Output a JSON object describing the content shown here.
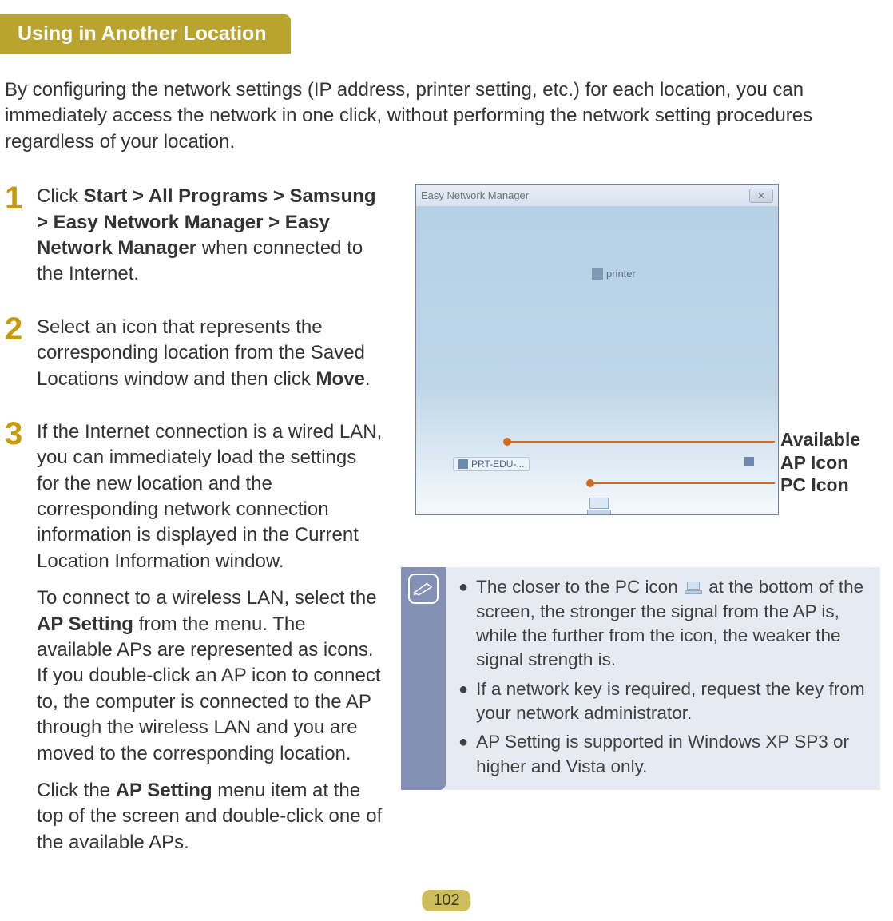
{
  "header": {
    "title": "Using in Another Location"
  },
  "intro": "By configuring the network settings (IP address, printer setting, etc.) for each location, you can immediately access the network in one click, without performing the network setting procedures regardless of your location.",
  "steps": [
    {
      "num": "1",
      "runs": [
        {
          "t": "Click ",
          "b": false
        },
        {
          "t": "Start > All Programs > Samsung > Easy Network Manager > Easy Network Manager",
          "b": true
        },
        {
          "t": " when connected to the Internet.",
          "b": false
        }
      ]
    },
    {
      "num": "2",
      "runs": [
        {
          "t": "Select an icon that represents the corresponding location from the Saved Locations window and then click ",
          "b": false
        },
        {
          "t": "Move",
          "b": true
        },
        {
          "t": ".",
          "b": false
        }
      ]
    },
    {
      "num": "3",
      "paras": [
        [
          {
            "t": "If the Internet connection is a wired LAN, you can immediately load the settings for the new location and the corresponding network connection information is displayed in the Current Location Information window.",
            "b": false
          }
        ],
        [
          {
            "t": "To connect to a wireless LAN, select the ",
            "b": false
          },
          {
            "t": "AP Setting",
            "b": true
          },
          {
            "t": " from the menu. The available APs are represented as icons. If you double-click an AP icon to connect to, the computer is connected to the AP through the wireless LAN and you are moved to the corresponding location.",
            "b": false
          }
        ],
        [
          {
            "t": "Click the ",
            "b": false
          },
          {
            "t": "AP Setting",
            "b": true
          },
          {
            "t": " menu item at the top of the screen and double-click one of the available APs.",
            "b": false
          }
        ]
      ]
    }
  ],
  "app_window": {
    "title": "Easy Network Manager",
    "close_glyph": "✕",
    "printer_label": "printer",
    "ap_label": "PRT-EDU-..."
  },
  "callouts": {
    "ap": "Available AP Icon",
    "pc": "PC Icon"
  },
  "notes": {
    "items": [
      {
        "pre": "The closer to the PC icon ",
        "post": " at the bottom of the screen, the stronger the signal from the AP is, while the further from the icon, the weaker the signal strength is.",
        "has_icon": true
      },
      {
        "pre": "If a network key is required, request the key from your network administrator.",
        "post": "",
        "has_icon": false
      },
      {
        "pre": "AP Setting is supported in Windows XP SP3 or higher and Vista only.",
        "post": "",
        "has_icon": false
      }
    ]
  },
  "page_number": "102"
}
